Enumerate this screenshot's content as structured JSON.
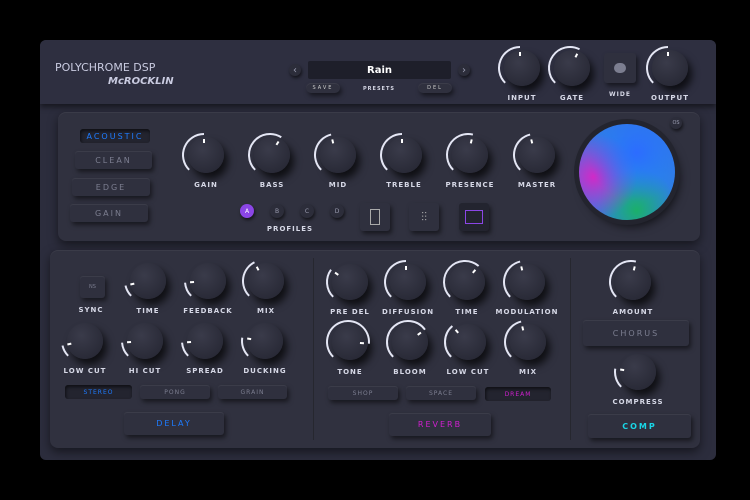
{
  "brand": {
    "logo": "POLYCHROME DSP",
    "sub": "McROCKLIN"
  },
  "preset": {
    "name": "Rain",
    "save": "SAVE",
    "label": "PRESETS",
    "del": "DEL",
    "prev": "‹",
    "next": "›"
  },
  "top_knobs": [
    {
      "label": "INPUT",
      "value": 0.5
    },
    {
      "label": "GATE",
      "value": 0.6
    }
  ],
  "wide": {
    "label": "WIDE"
  },
  "output": {
    "label": "OUTPUT",
    "value": 0.5
  },
  "amp": {
    "modes": [
      {
        "label": "ACOUSTIC",
        "active": true
      },
      {
        "label": "CLEAN"
      },
      {
        "label": "EDGE"
      },
      {
        "label": "GAIN"
      }
    ],
    "knobs": [
      {
        "label": "GAIN",
        "value": 0.5
      },
      {
        "label": "BASS",
        "value": 0.62
      },
      {
        "label": "MID",
        "value": 0.45
      },
      {
        "label": "TREBLE",
        "value": 0.5
      },
      {
        "label": "PRESENCE",
        "value": 0.55
      },
      {
        "label": "MASTER",
        "value": 0.45
      }
    ],
    "profiles": {
      "items": [
        "A",
        "B",
        "C",
        "D"
      ],
      "active": "A",
      "label": "PROFILES"
    },
    "os": "OS"
  },
  "delay": {
    "ns": "NS",
    "sync": "SYNC",
    "knobs": [
      {
        "label": "TIME",
        "value": 0.12
      },
      {
        "label": "FEEDBACK",
        "value": 0.15
      },
      {
        "label": "MIX",
        "value": 0.4
      },
      {
        "label": "LOW CUT",
        "value": 0.12
      },
      {
        "label": "HI CUT",
        "value": 0.15
      },
      {
        "label": "SPREAD",
        "value": 0.15
      },
      {
        "label": "DUCKING",
        "value": 0.2
      }
    ],
    "modes": [
      {
        "label": "STEREO",
        "active": true
      },
      {
        "label": "PONG"
      },
      {
        "label": "GRAIN"
      }
    ],
    "title": "DELAY"
  },
  "reverb": {
    "knobs": [
      {
        "label": "PRE DEL",
        "value": 0.3
      },
      {
        "label": "DIFFUSION",
        "value": 0.5
      },
      {
        "label": "TIME",
        "value": 0.65
      },
      {
        "label": "MODULATION",
        "value": 0.45
      },
      {
        "label": "TONE",
        "value": 0.85
      },
      {
        "label": "BLOOM",
        "value": 0.7
      },
      {
        "label": "LOW CUT",
        "value": 0.35
      },
      {
        "label": "MIX",
        "value": 0.45
      }
    ],
    "modes": [
      {
        "label": "SHOP"
      },
      {
        "label": "SPACE"
      },
      {
        "label": "DREAM",
        "active": true
      }
    ],
    "title": "REVERB"
  },
  "comp": {
    "amount": {
      "label": "AMOUNT",
      "value": 0.55
    },
    "chorus": "CHORUS",
    "compress": {
      "label": "COMPRESS",
      "value": 0.2
    },
    "title": "COMP"
  },
  "colors": {
    "delay": "#1e7bff",
    "reverb": "#d01fd0",
    "comp": "#19d6e6",
    "profile": "#8b46e6"
  }
}
